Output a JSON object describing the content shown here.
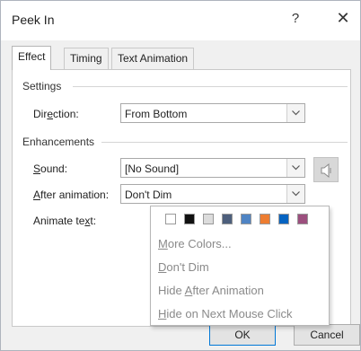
{
  "window": {
    "title": "Peek In",
    "help_glyph": "?",
    "close_glyph": "✕"
  },
  "tabs": [
    {
      "label": "Effect",
      "active": true
    },
    {
      "label": "Timing",
      "active": false
    },
    {
      "label": "Text Animation",
      "active": false
    }
  ],
  "settings": {
    "group_label": "Settings",
    "direction_label_pre": "Dir",
    "direction_label_accel": "e",
    "direction_label_post": "ction:",
    "direction_value": "From Bottom"
  },
  "enhancements": {
    "group_label": "Enhancements",
    "sound_label_accel": "S",
    "sound_label_post": "ound:",
    "sound_value": "[No Sound]",
    "after_label_accel": "A",
    "after_label_post": "fter animation:",
    "after_value": "Don't Dim",
    "animate_label_pre": "Animate te",
    "animate_label_accel": "x",
    "animate_label_post": "t:"
  },
  "color_popup": {
    "swatch_colors": [
      "#ffffff",
      "#111111",
      "#dcdcdc",
      "#4d5f7c",
      "#4f84c4",
      "#ed7d31",
      "#0563c1",
      "#9c4f7e"
    ],
    "items": [
      {
        "pre": "",
        "accel": "M",
        "post": "ore Colors..."
      },
      {
        "pre": "",
        "accel": "D",
        "post": "on't Dim"
      },
      {
        "pre": "Hide ",
        "accel": "A",
        "post": "fter Animation"
      },
      {
        "pre": "",
        "accel": "H",
        "post": "ide on Next Mouse Click"
      }
    ]
  },
  "footer": {
    "ok_label": "OK",
    "cancel_label": "Cancel"
  },
  "colors": {
    "accent": "#0078d7",
    "disabled_text": "#8a8a8a"
  }
}
